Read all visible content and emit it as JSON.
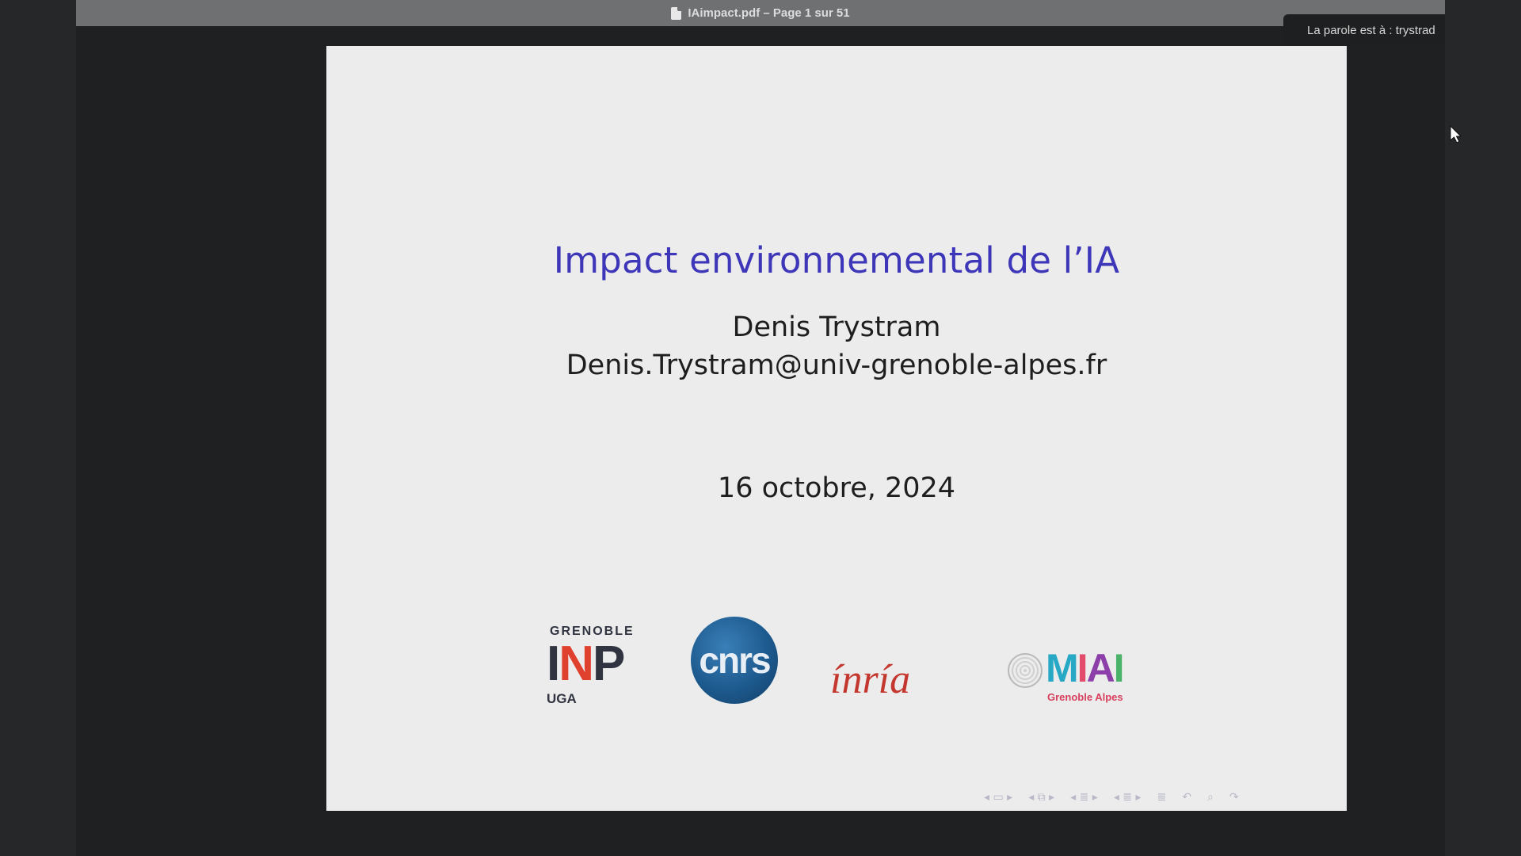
{
  "window": {
    "title": "IAimpact.pdf – Page 1 sur 51",
    "doc_icon": "document-icon"
  },
  "meeting": {
    "speaker_text": "La parole est à : trystrad"
  },
  "slide": {
    "title": "Impact environnemental de l’IA",
    "author": "Denis Trystram",
    "email": "Denis.Trystram@univ-grenoble-alpes.fr",
    "date": "16 octobre, 2024",
    "logos": {
      "inp": {
        "top": "GRENOBLE",
        "main_a": "I",
        "main_b": "N",
        "main_c": "P",
        "bottom": "UGA"
      },
      "cnrs": "cnrs",
      "inria": "ínría",
      "miai": {
        "m": "M",
        "i1": "I",
        "a": "A",
        "i2": "I",
        "sub": "Grenoble Alpes"
      }
    },
    "nav_icons": [
      "prev-slide-icon",
      "frame-icon",
      "subsection-icon",
      "section-icon",
      "outline-icon",
      "undo-icon",
      "search-icon",
      "redo-icon"
    ]
  },
  "colors": {
    "title": "#3d36b8",
    "text": "#1e1e1e",
    "slide_bg": "#ececec",
    "viewer_bg": "#1f2021"
  }
}
